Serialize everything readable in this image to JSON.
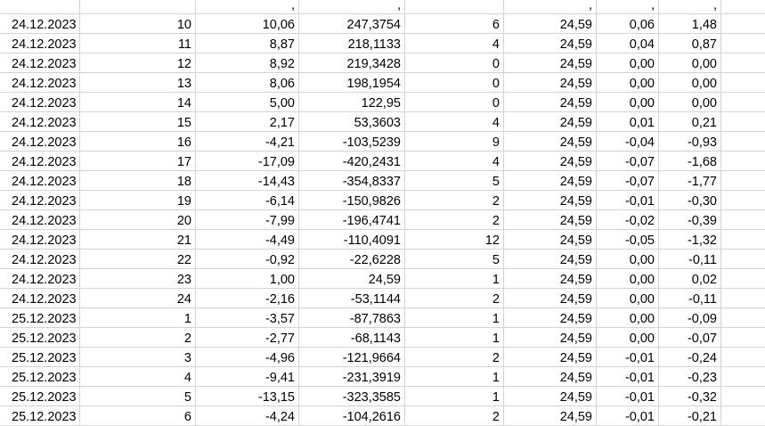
{
  "sheet": {
    "top_partial_row": [
      "",
      "",
      ",",
      ",",
      "",
      ",",
      ",",
      ","
    ],
    "rows": [
      [
        "24.12.2023",
        "10",
        "10,06",
        "247,3754",
        "6",
        "24,59",
        "0,06",
        "1,48"
      ],
      [
        "24.12.2023",
        "11",
        "8,87",
        "218,1133",
        "4",
        "24,59",
        "0,04",
        "0,87"
      ],
      [
        "24.12.2023",
        "12",
        "8,92",
        "219,3428",
        "0",
        "24,59",
        "0,00",
        "0,00"
      ],
      [
        "24.12.2023",
        "13",
        "8,06",
        "198,1954",
        "0",
        "24,59",
        "0,00",
        "0,00"
      ],
      [
        "24.12.2023",
        "14",
        "5,00",
        "122,95",
        "0",
        "24,59",
        "0,00",
        "0,00"
      ],
      [
        "24.12.2023",
        "15",
        "2,17",
        "53,3603",
        "4",
        "24,59",
        "0,01",
        "0,21"
      ],
      [
        "24.12.2023",
        "16",
        "-4,21",
        "-103,5239",
        "9",
        "24,59",
        "-0,04",
        "-0,93"
      ],
      [
        "24.12.2023",
        "17",
        "-17,09",
        "-420,2431",
        "4",
        "24,59",
        "-0,07",
        "-1,68"
      ],
      [
        "24.12.2023",
        "18",
        "-14,43",
        "-354,8337",
        "5",
        "24,59",
        "-0,07",
        "-1,77"
      ],
      [
        "24.12.2023",
        "19",
        "-6,14",
        "-150,9826",
        "2",
        "24,59",
        "-0,01",
        "-0,30"
      ],
      [
        "24.12.2023",
        "20",
        "-7,99",
        "-196,4741",
        "2",
        "24,59",
        "-0,02",
        "-0,39"
      ],
      [
        "24.12.2023",
        "21",
        "-4,49",
        "-110,4091",
        "12",
        "24,59",
        "-0,05",
        "-1,32"
      ],
      [
        "24.12.2023",
        "22",
        "-0,92",
        "-22,6228",
        "5",
        "24,59",
        "0,00",
        "-0,11"
      ],
      [
        "24.12.2023",
        "23",
        "1,00",
        "24,59",
        "1",
        "24,59",
        "0,00",
        "0,02"
      ],
      [
        "24.12.2023",
        "24",
        "-2,16",
        "-53,1144",
        "2",
        "24,59",
        "0,00",
        "-0,11"
      ],
      [
        "25.12.2023",
        "1",
        "-3,57",
        "-87,7863",
        "1",
        "24,59",
        "0,00",
        "-0,09"
      ],
      [
        "25.12.2023",
        "2",
        "-2,77",
        "-68,1143",
        "1",
        "24,59",
        "0,00",
        "-0,07"
      ],
      [
        "25.12.2023",
        "3",
        "-4,96",
        "-121,9664",
        "2",
        "24,59",
        "-0,01",
        "-0,24"
      ],
      [
        "25.12.2023",
        "4",
        "-9,41",
        "-231,3919",
        "1",
        "24,59",
        "-0,01",
        "-0,23"
      ],
      [
        "25.12.2023",
        "5",
        "-13,15",
        "-323,3585",
        "1",
        "24,59",
        "-0,01",
        "-0,32"
      ],
      [
        "25.12.2023",
        "6",
        "-4,24",
        "-104,2616",
        "2",
        "24,59",
        "-0,01",
        "-0,21"
      ]
    ]
  }
}
